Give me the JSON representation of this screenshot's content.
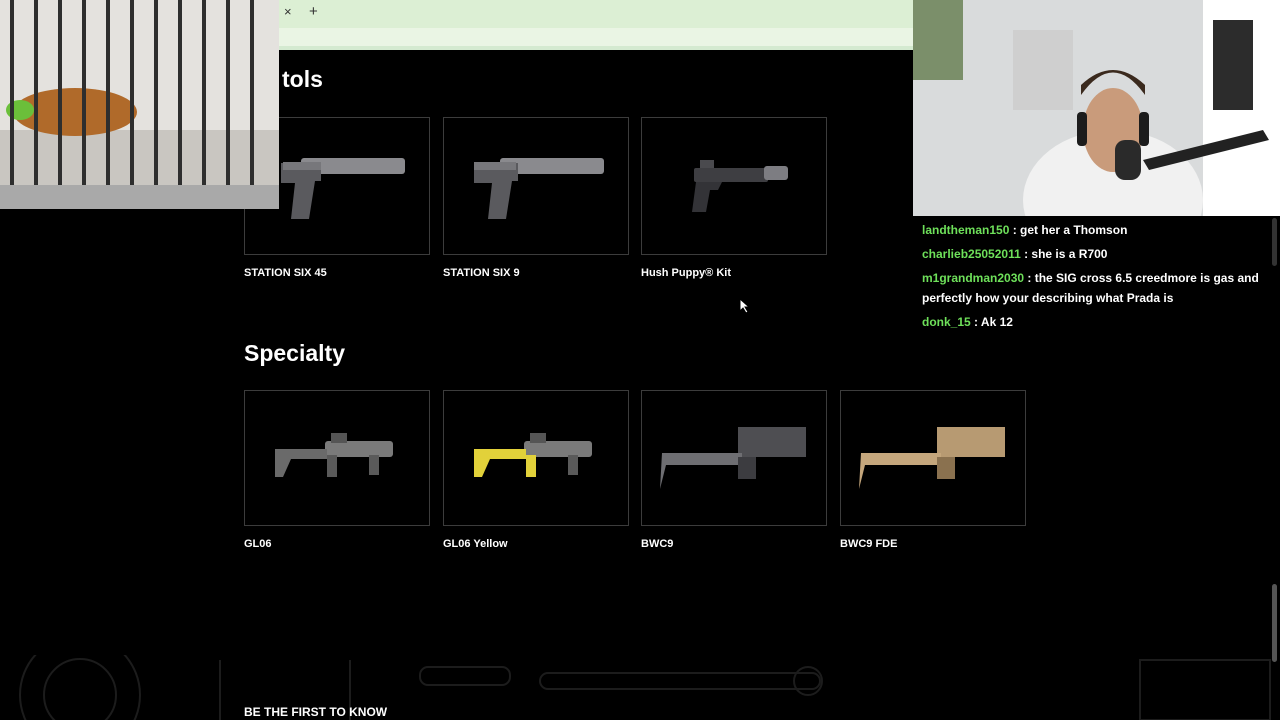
{
  "browser": {
    "close_tab_glyph": "×",
    "new_tab_glyph": "+"
  },
  "sections": {
    "pistols": {
      "title_visible": "tols",
      "products": [
        {
          "name": "STATION SIX 45",
          "icon": "suppressed-pistol-image"
        },
        {
          "name": "STATION SIX 9",
          "icon": "suppressed-pistol-image"
        },
        {
          "name": "Hush Puppy® Kit",
          "icon": "glock-suppressor-kit-image"
        }
      ]
    },
    "specialty": {
      "title": "Specialty",
      "products": [
        {
          "name": "GL06",
          "icon": "grenade-launcher-image",
          "color": "#7a7a7a"
        },
        {
          "name": "GL06 Yellow",
          "icon": "grenade-launcher-image",
          "color": "#e2d13a"
        },
        {
          "name": "BWC9",
          "icon": "folding-carbine-image",
          "color": "#6e6e6e"
        },
        {
          "name": "BWC9 FDE",
          "icon": "folding-carbine-image",
          "color": "#b79a72"
        }
      ]
    }
  },
  "chat": {
    "messages": [
      {
        "user": "landtheman150",
        "text": ": get her a Thomson"
      },
      {
        "user": "charlieb25052011",
        "text": ": she is a R700"
      },
      {
        "user": "m1grandman2030",
        "text": ": the SIG cross 6.5 creedmore is gas and perfectly how your describing what Prada is"
      },
      {
        "user": "donk_15",
        "text": ": Ak 12"
      }
    ],
    "user_color": "#6ee05a"
  },
  "footer": {
    "newsletter_title": "BE THE FIRST TO KNOW"
  },
  "colors": {
    "background": "#000000",
    "card_border": "#3c3c3c",
    "tab_strip": "#dcefd4"
  }
}
